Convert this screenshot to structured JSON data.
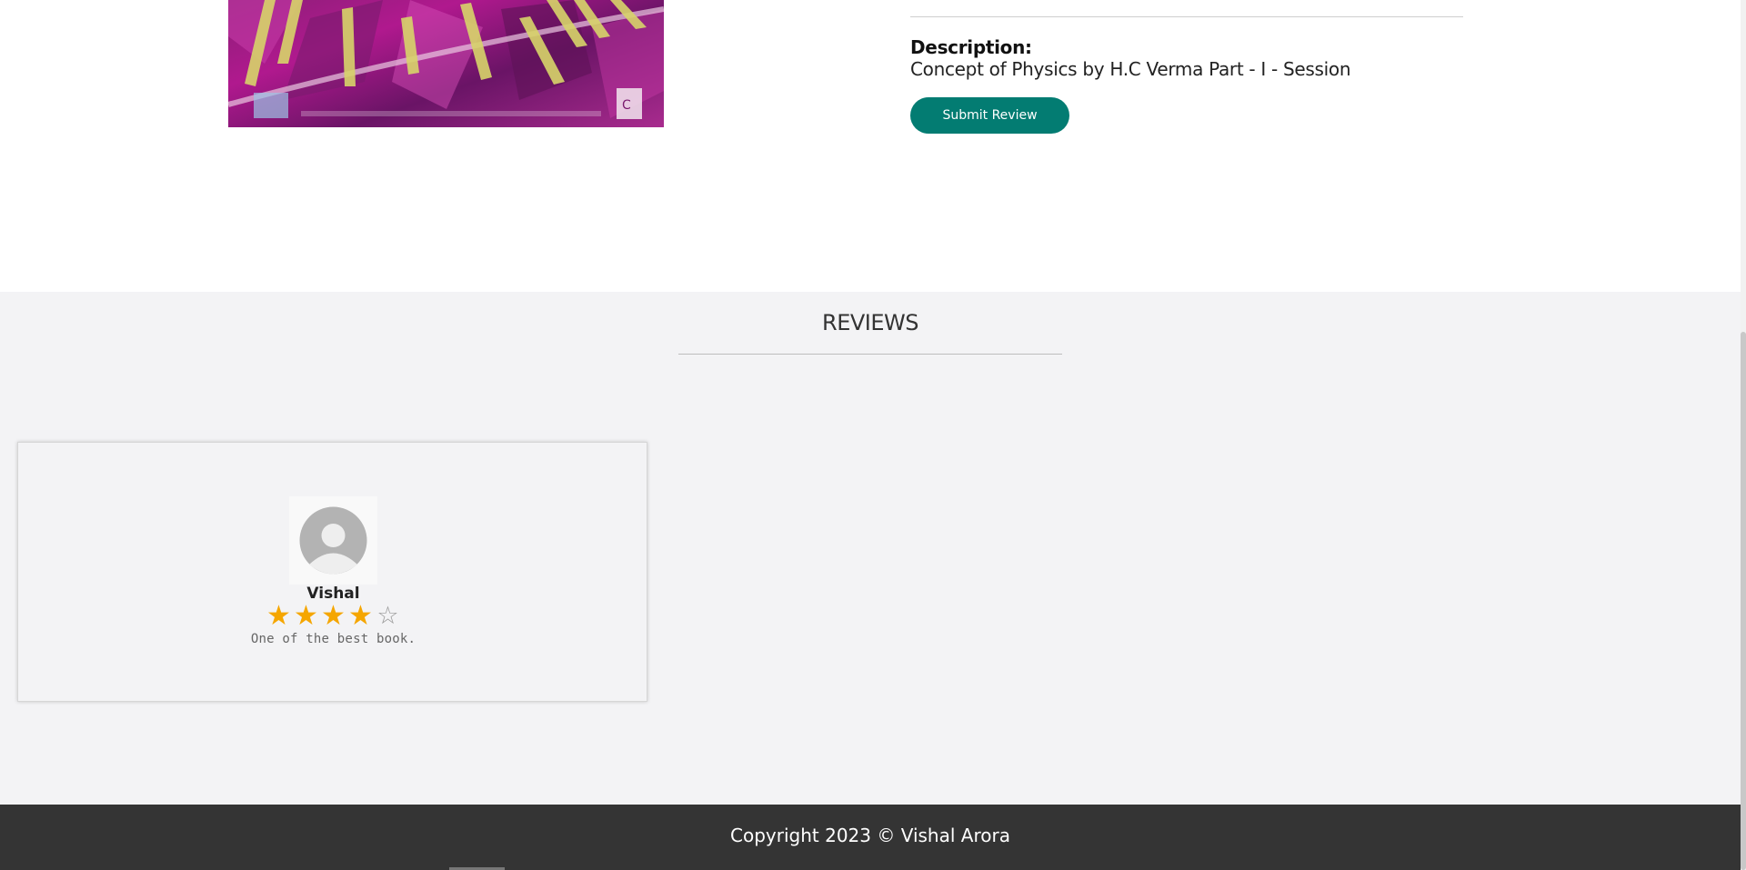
{
  "product": {
    "description_label": "Description:",
    "description_text": "Concept of Physics by H.C Verma Part - I - Session",
    "submit_review_label": "Submit Review",
    "image_icon": "book-cover-image"
  },
  "reviews": {
    "title": "REVIEWS",
    "items": [
      {
        "name": "Vishal",
        "rating": 4,
        "max_rating": 5,
        "comment": "One of the best book.",
        "avatar_icon": "user-avatar-icon"
      }
    ]
  },
  "footer": {
    "copyright": "Copyright 2023 © Vishal Arora"
  },
  "colors": {
    "accent": "#037c72",
    "star": "#f5a600",
    "footer_bg": "#343434",
    "reviews_bg": "#f3f3f5"
  }
}
